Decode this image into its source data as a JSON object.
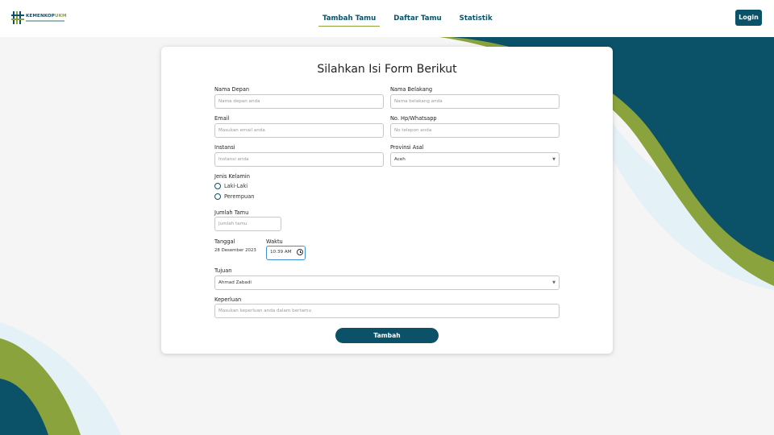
{
  "logo": {
    "brand_main": "KEMENKOP",
    "brand_accent": "UKM"
  },
  "nav": {
    "links": [
      {
        "label": "Tambah Tamu",
        "active": true
      },
      {
        "label": "Daftar Tamu",
        "active": false
      },
      {
        "label": "Statistik",
        "active": false
      }
    ],
    "login_label": "Login"
  },
  "form": {
    "title": "Silahkan Isi Form Berikut",
    "first_name": {
      "label": "Nama Depan",
      "placeholder": "Nama depan anda"
    },
    "last_name": {
      "label": "Nama Belakang",
      "placeholder": "Nama belakang anda"
    },
    "email": {
      "label": "Email",
      "placeholder": "Masukan email anda"
    },
    "phone": {
      "label": "No. Hp/Whatsapp",
      "placeholder": "No telepon anda"
    },
    "institution": {
      "label": "Instansi",
      "placeholder": "Instansi anda"
    },
    "province": {
      "label": "Provinsi Asal",
      "value": "Aceh"
    },
    "gender": {
      "label": "Jenis Kelamin",
      "options": [
        "Laki-Laki",
        "Perempuan"
      ]
    },
    "guest_count": {
      "label": "Jumlah Tamu",
      "placeholder": "Jumlah tamu"
    },
    "date": {
      "label": "Tanggal",
      "value": "28 Desember 2023"
    },
    "time": {
      "label": "Waktu",
      "value": "10:39 AM"
    },
    "purpose": {
      "label": "Tujuan",
      "value": "Ahmad Zabadi"
    },
    "need": {
      "label": "Keperluan",
      "placeholder": "Masukan keperluan anda dalam bertamu"
    },
    "submit_label": "Tambah"
  },
  "colors": {
    "primary": "#0b5268",
    "accent_green": "#8aa33c",
    "light_blue": "#e4f1f6"
  },
  "icons": [
    "logo-mark-icon",
    "chevron-down-icon",
    "clock-icon"
  ]
}
